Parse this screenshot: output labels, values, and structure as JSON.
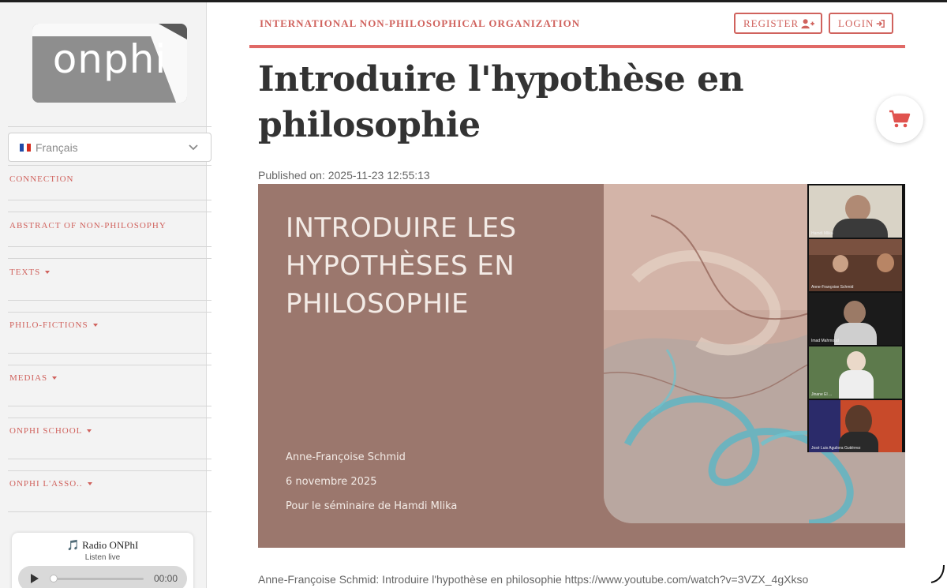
{
  "sidebar": {
    "logo_text": "onphi",
    "language": {
      "label": "Français",
      "flag_colors": [
        "#1f4aa8",
        "#ffffff",
        "#d52b1e"
      ]
    },
    "nav": [
      {
        "label": "CONNECTION",
        "has_caret": false
      },
      {
        "label": "ABSTRACT OF NON-PHILOSOPHY",
        "has_caret": false
      },
      {
        "label": "TEXTS",
        "has_caret": true
      },
      {
        "label": "PHILO-FICTIONS",
        "has_caret": true
      },
      {
        "label": "MEDIAS",
        "has_caret": true
      },
      {
        "label": "ONPHI SCHOOL",
        "has_caret": true
      },
      {
        "label": "ONPHI L'ASSO..",
        "has_caret": true
      }
    ],
    "radio": {
      "title": "🎵 Radio ONPhI",
      "subtitle": "Listen live",
      "time": "00:00"
    }
  },
  "header": {
    "organization": "INTERNATIONAL NON-PHILOSOPHICAL ORGANIZATION",
    "register_label": "REGISTER",
    "login_label": "LOGIN"
  },
  "article": {
    "title": "Introduire l'hypothèse en philosophie",
    "published": "Published on: 2025-11-23 12:55:13",
    "caption": "Anne-Françoise Schmid: Introduire l'hypothèse en philosophie https://www.youtube.com/watch?v=3VZX_4gXkso"
  },
  "video": {
    "slide_title": "INTRODUIRE LES HYPOTHÈSES EN PHILOSOPHIE",
    "author": "Anne-Françoise Schmid",
    "date": "6 novembre 2025",
    "context": "Pour le séminaire de Hamdi Mlika",
    "participants": [
      "Hamdi Mlika",
      "Anne-Françoise Schmid",
      "Imad Mahmoud",
      "Jinane El ...",
      "José Luis Aguilera Gutiérrez"
    ]
  },
  "colors": {
    "accent": "#d0625d",
    "rule": "#e06966",
    "slide_bg": "#9b776d"
  },
  "icons": {
    "cart": "cart-icon",
    "register": "user-plus-icon",
    "login": "sign-in-icon",
    "play": "play-icon"
  }
}
